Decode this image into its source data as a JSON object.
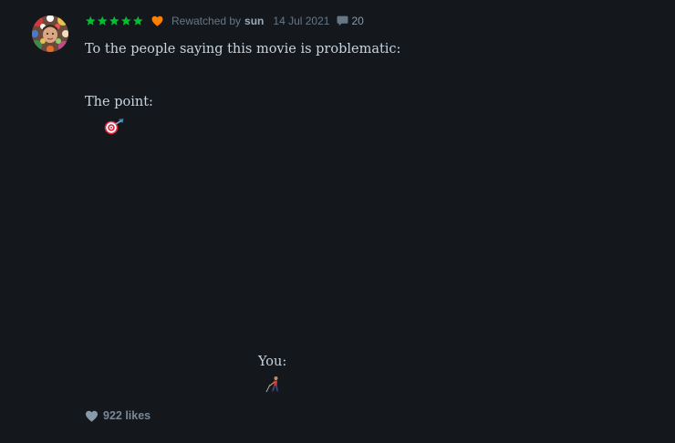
{
  "review": {
    "rating_stars": 5,
    "liked": true,
    "rewatched_label": "Rewatched by",
    "username": "sun",
    "date": "14 Jul 2021",
    "comment_count": "20",
    "lines": {
      "line1": "To the people saying this movie is problematic:",
      "line2": "The point:",
      "line3": "You:"
    },
    "emoji_point": "target-with-arrow-missing",
    "emoji_you": "person-walking-away",
    "likes_label": "922 likes"
  },
  "colors": {
    "background": "#14181c",
    "star": "#00c030",
    "heart_liked": "#ff8000",
    "meta_text": "#667788",
    "body_text": "#c8d4df"
  },
  "icons": {
    "star": "star-icon",
    "heart": "heart-icon",
    "comment": "comment-icon"
  }
}
